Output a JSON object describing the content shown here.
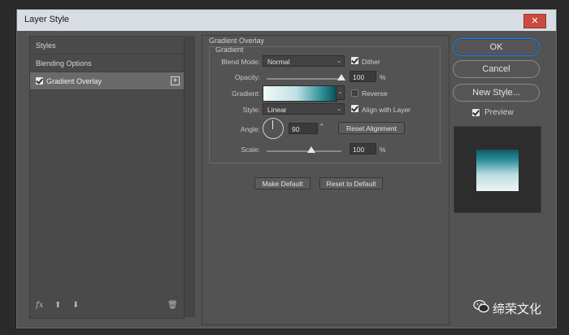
{
  "window": {
    "title": "Layer Style",
    "close_icon": "close-x-icon"
  },
  "left_panel": {
    "items": [
      {
        "label": "Styles"
      },
      {
        "label": "Blending Options"
      },
      {
        "label": "Gradient Overlay",
        "checked": true
      }
    ],
    "add_icon": "plus-square-icon",
    "footer_icons": [
      "fx-icon",
      "move-up-arrow-icon",
      "move-down-arrow-icon",
      "trash-icon"
    ],
    "fx_label": "fx"
  },
  "gradient_overlay": {
    "section_title": "Gradient Overlay",
    "group_title": "Gradient",
    "blend_mode": {
      "label": "Blend Mode:",
      "value": "Normal"
    },
    "dither": {
      "label": "Dither",
      "checked": true
    },
    "opacity": {
      "label": "Opacity:",
      "value": "100",
      "unit": "%",
      "level": 1.0
    },
    "gradient": {
      "label": "Gradient:",
      "colors": [
        "#f1f8f8",
        "#bfe1e4",
        "#2f8f99",
        "#0b4f57"
      ]
    },
    "reverse": {
      "label": "Reverse",
      "checked": false
    },
    "style": {
      "label": "Style:",
      "value": "Linear"
    },
    "align_with_layer": {
      "label": "Align with Layer",
      "checked": true
    },
    "angle": {
      "label": "Angle:",
      "value": "90",
      "unit": "°"
    },
    "reset_alignment_label": "Reset Alignment",
    "scale": {
      "label": "Scale:",
      "value": "100",
      "unit": "%",
      "level": 0.6
    },
    "make_default_label": "Make Default",
    "reset_to_default_label": "Reset to Default"
  },
  "right_panel": {
    "ok_label": "OK",
    "cancel_label": "Cancel",
    "new_style_label": "New Style...",
    "preview": {
      "label": "Preview",
      "checked": true
    }
  },
  "watermark": {
    "text": "缔荣文化",
    "icon": "wechat-icon"
  },
  "colors": {
    "accent_focus": "#2f7ad1",
    "close_red": "#c94a3f",
    "panel_bg": "#535353"
  }
}
